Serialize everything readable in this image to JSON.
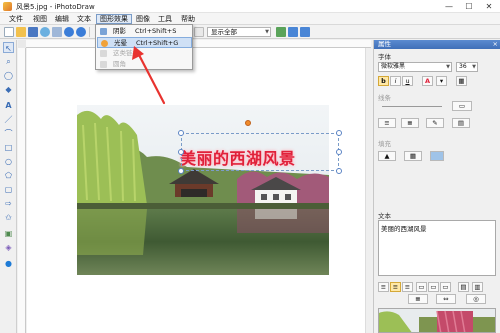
{
  "window": {
    "title": "风景5.jpg - iPhotoDraw",
    "minimize_glyph": "—",
    "maximize_glyph": "☐",
    "close_glyph": "✕"
  },
  "menubar": {
    "items": [
      "文件",
      "视图",
      "编辑",
      "文本",
      "图形效果",
      "图像",
      "工具",
      "帮助"
    ],
    "active_index": 4
  },
  "toolbar": {
    "zoom_label": "显示全部"
  },
  "effects_menu": {
    "items": [
      {
        "label": "阴影",
        "shortcut": "Ctrl+Shift+S",
        "state": "normal"
      },
      {
        "label": "光晕",
        "shortcut": "Ctrl+Shift+G",
        "state": "highlighted"
      },
      {
        "label": "这类链接",
        "shortcut": "",
        "state": "disabled"
      },
      {
        "label": "圆角",
        "shortcut": "",
        "state": "disabled"
      }
    ]
  },
  "canvas": {
    "overlay_text": "美丽的西湖风景",
    "text_color": "#e0213a",
    "glow_color": "#ff98a6"
  },
  "panel": {
    "title": "属性",
    "close_glyph": "×",
    "font_section_label": "字体",
    "font_name": "微软雅黑",
    "font_size": "36",
    "bold_label": "b",
    "italic_label": "i",
    "underline_label": "u",
    "text_color_label": "A",
    "line_section_label": "线条",
    "fill_section_label": "填充",
    "text_section_label": "文本",
    "text_value": "美丽的西湖风景"
  },
  "icons": {
    "tools": [
      "select-arrow-icon",
      "zoom-icon",
      "lasso-icon",
      "fill-icon",
      "text-icon",
      "line-icon",
      "polyline-icon",
      "rectangle-icon",
      "ellipse-icon",
      "polygon-icon",
      "callout-icon",
      "arrow-icon",
      "star-icon",
      "image-icon",
      "mosaic-icon",
      "info-icon"
    ]
  }
}
